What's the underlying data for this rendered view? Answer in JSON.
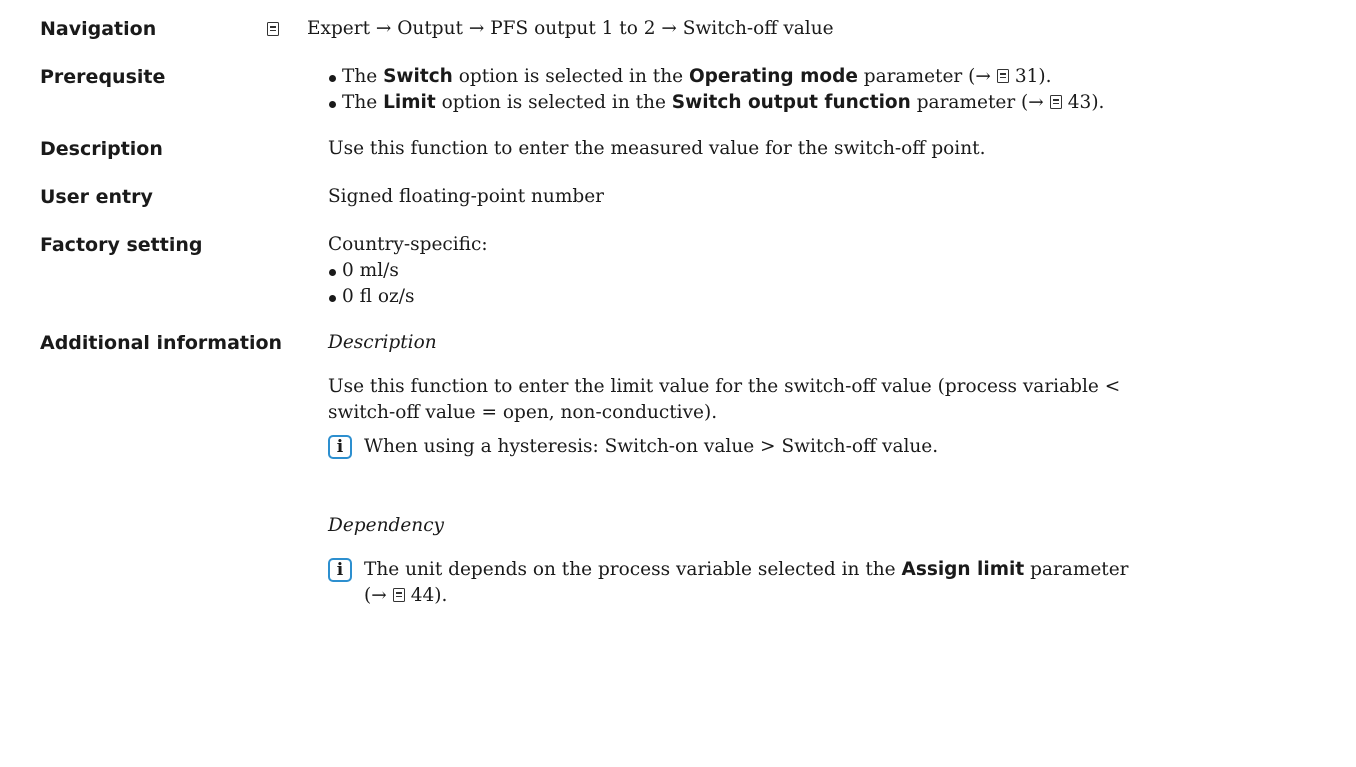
{
  "navigation": {
    "label": "Navigation",
    "path": "Expert → Output → PFS output 1 to 2 → Switch-off value"
  },
  "prerequisite": {
    "label": "Prerequsite",
    "item1": {
      "pre": "The ",
      "opt": "Switch",
      "mid": " option is selected in the ",
      "param": "Operating mode",
      "post": " parameter (→",
      "page": "31",
      "end": ")."
    },
    "item2": {
      "pre": "The ",
      "opt": "Limit",
      "mid": " option is selected in the ",
      "param": "Switch output function",
      "post": " parameter (→",
      "page": "43",
      "end": ")."
    }
  },
  "description": {
    "label": "Description",
    "text": "Use this function to enter the measured value for the switch-off point."
  },
  "user_entry": {
    "label": "User entry",
    "text": "Signed floating-point number"
  },
  "factory_setting": {
    "label": "Factory setting",
    "intro": "Country-specific:",
    "items": [
      "0 ml/s",
      "0 fl oz/s"
    ]
  },
  "additional_information": {
    "label": "Additional information",
    "desc_heading": "Description",
    "desc_line1": "Use this function to enter the limit value for the switch-off value (process variable <",
    "desc_line2": "switch-off value = open, non-conductive).",
    "note1": "When using a hysteresis: Switch-on value > Switch-off value.",
    "dep_heading": "Dependency",
    "note2_pre": "The unit depends on the process variable selected in the ",
    "note2_param": "Assign limit",
    "note2_post": " parameter",
    "note2_line2_pre": "(→",
    "note2_page": "44",
    "note2_end": ")."
  }
}
